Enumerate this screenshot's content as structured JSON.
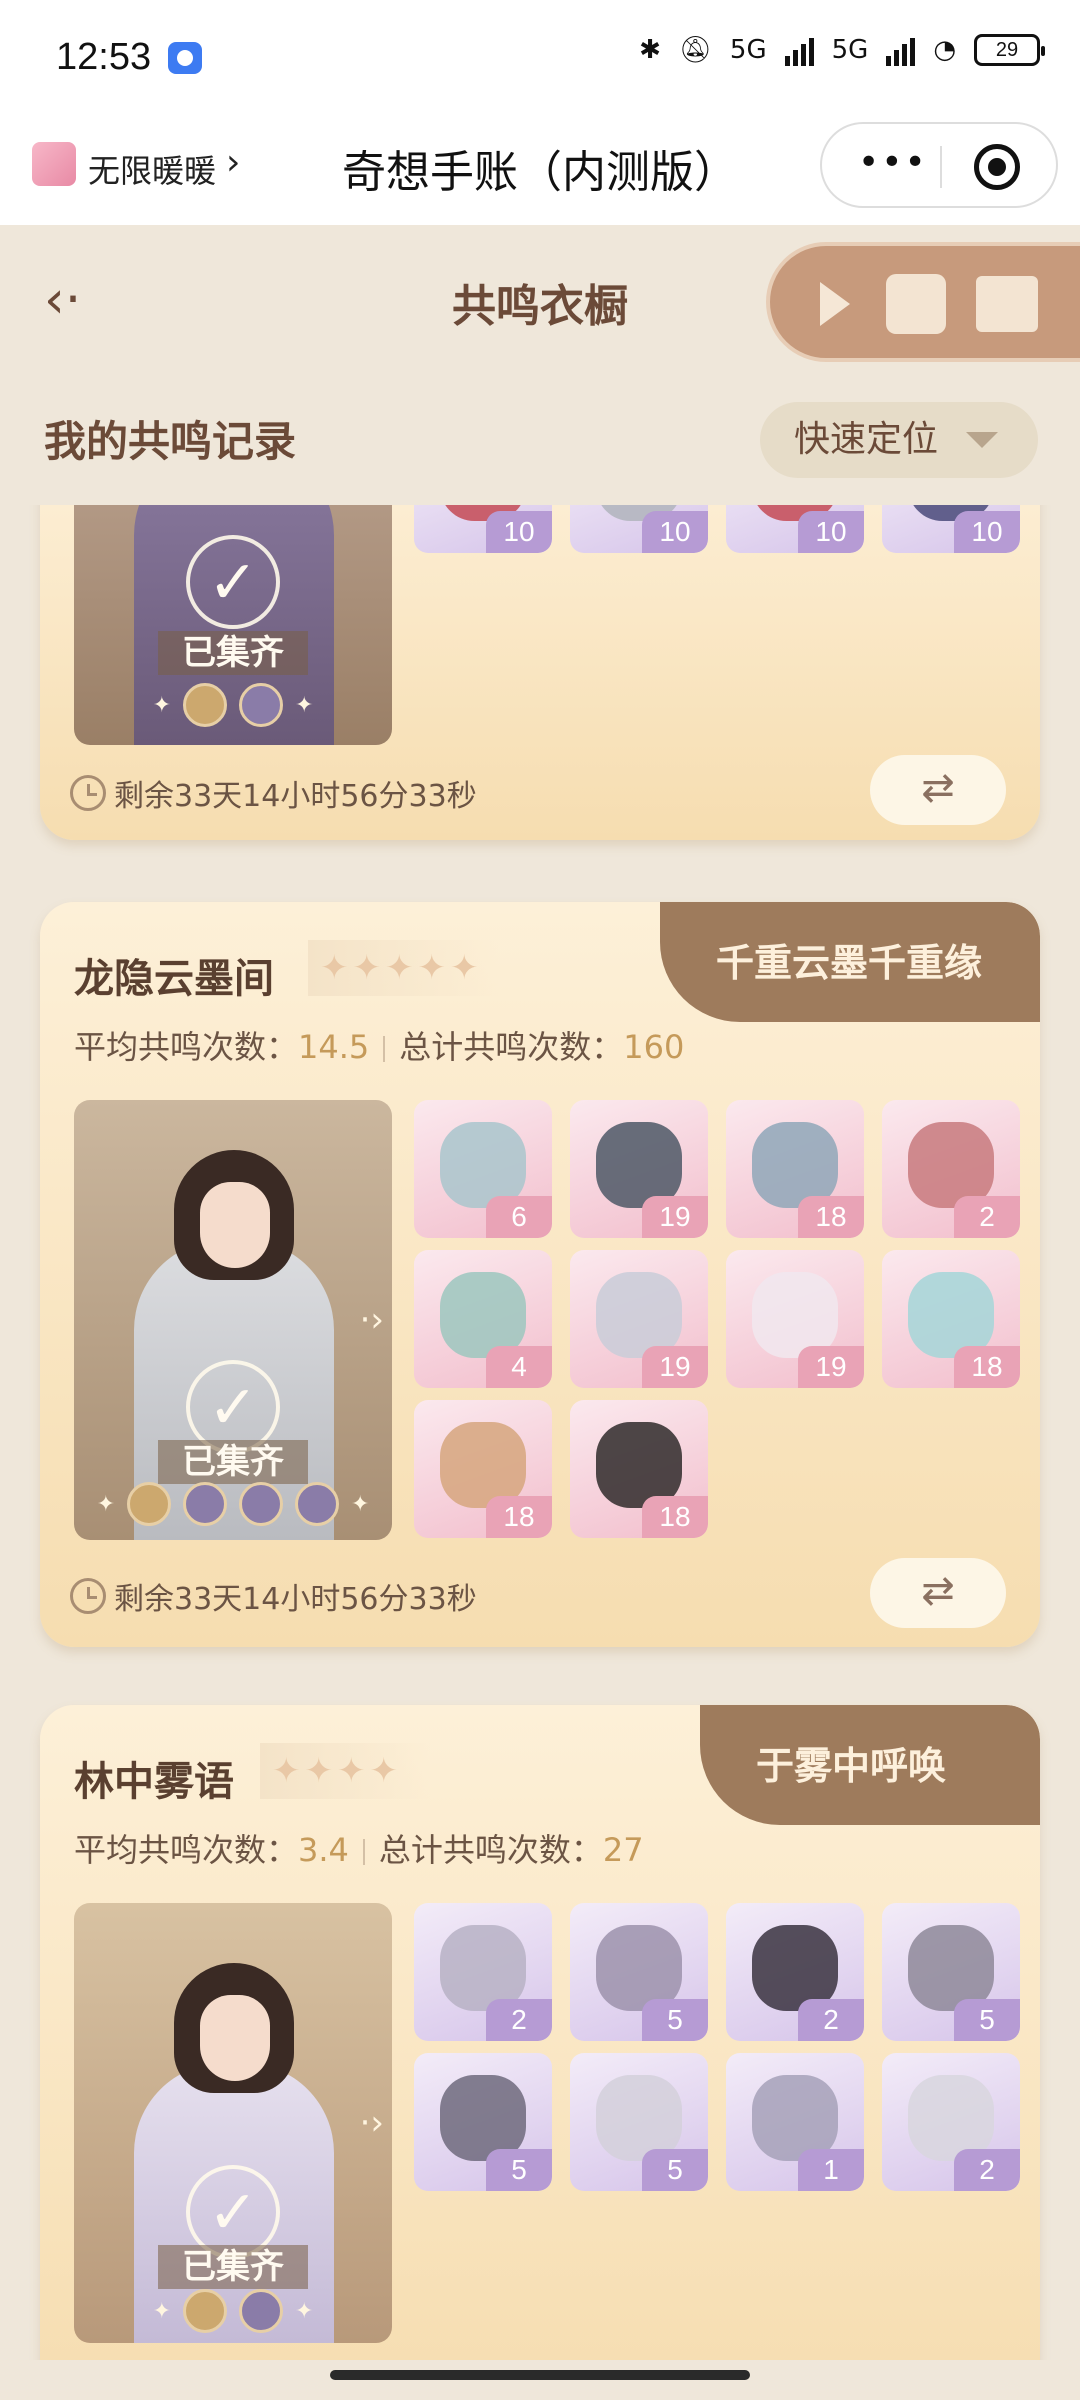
{
  "status_bar": {
    "time": "12:53",
    "network_1": "5G",
    "network_2": "5G",
    "battery": "29"
  },
  "miniprogram": {
    "app_name": "无限暖暖",
    "chevron": "›",
    "title": "奇想手账（内测版）",
    "more": "•••"
  },
  "header": {
    "back_icon": "‹·",
    "title": "共鸣衣橱"
  },
  "section": {
    "title": "我的共鸣记录",
    "locate_label": "快速定位"
  },
  "cards": [
    {
      "collected_label": "已集齐",
      "items": [
        {
          "count": "10",
          "tone": "purple",
          "color": "#c44a55"
        },
        {
          "count": "10",
          "tone": "purple",
          "color": "#b0b4bc"
        },
        {
          "count": "10",
          "tone": "purple",
          "color": "#c44a55"
        },
        {
          "count": "10",
          "tone": "purple",
          "color": "#4a4a7a"
        }
      ],
      "timer": "剩余33天14小时56分33秒",
      "swap_icon": "⇄"
    },
    {
      "name": "龙隐云墨间",
      "stars": [
        "✦",
        "✦",
        "✦",
        "✦",
        "✦"
      ],
      "banner": "千重云墨千重缘",
      "avg_label": "平均共鸣次数：",
      "avg_value": "14.5",
      "total_label": "总计共鸣次数：",
      "total_value": "160",
      "collected_label": "已集齐",
      "items": [
        {
          "count": "6",
          "tone": "pink",
          "color": "#a9c6cc"
        },
        {
          "count": "19",
          "tone": "pink",
          "color": "#4e5866"
        },
        {
          "count": "18",
          "tone": "pink",
          "color": "#8fa7b8"
        },
        {
          "count": "2",
          "tone": "pink",
          "color": "#c87a7e"
        },
        {
          "count": "4",
          "tone": "pink",
          "color": "#9cc7be"
        },
        {
          "count": "19",
          "tone": "pink",
          "color": "#c9cdd8"
        },
        {
          "count": "19",
          "tone": "pink",
          "color": "#f1e8ee"
        },
        {
          "count": "18",
          "tone": "pink",
          "color": "#a5d6d8"
        },
        {
          "count": "18",
          "tone": "pink",
          "color": "#d6a67e"
        },
        {
          "count": "18",
          "tone": "pink",
          "color": "#2f2a2a"
        }
      ],
      "timer": "剩余33天14小时56分33秒",
      "swap_icon": "⇄"
    },
    {
      "name": "林中雾语",
      "stars": [
        "✦",
        "✦",
        "✦",
        "✦"
      ],
      "banner": "于雾中呼唤",
      "avg_label": "平均共鸣次数：",
      "avg_value": "3.4",
      "total_label": "总计共鸣次数：",
      "total_value": "27",
      "collected_label": "已集齐",
      "items": [
        {
          "count": "2",
          "tone": "purple",
          "color": "#b7b2c4"
        },
        {
          "count": "5",
          "tone": "purple",
          "color": "#9c92ab"
        },
        {
          "count": "2",
          "tone": "purple",
          "color": "#3a3340"
        },
        {
          "count": "5",
          "tone": "purple",
          "color": "#8e8899"
        },
        {
          "count": "5",
          "tone": "purple",
          "color": "#6e6a7c"
        },
        {
          "count": "5",
          "tone": "purple",
          "color": "#d4d0da"
        },
        {
          "count": "1",
          "tone": "purple",
          "color": "#a6a1b8"
        },
        {
          "count": "2",
          "tone": "purple",
          "color": "#d8d6de"
        }
      ]
    }
  ]
}
